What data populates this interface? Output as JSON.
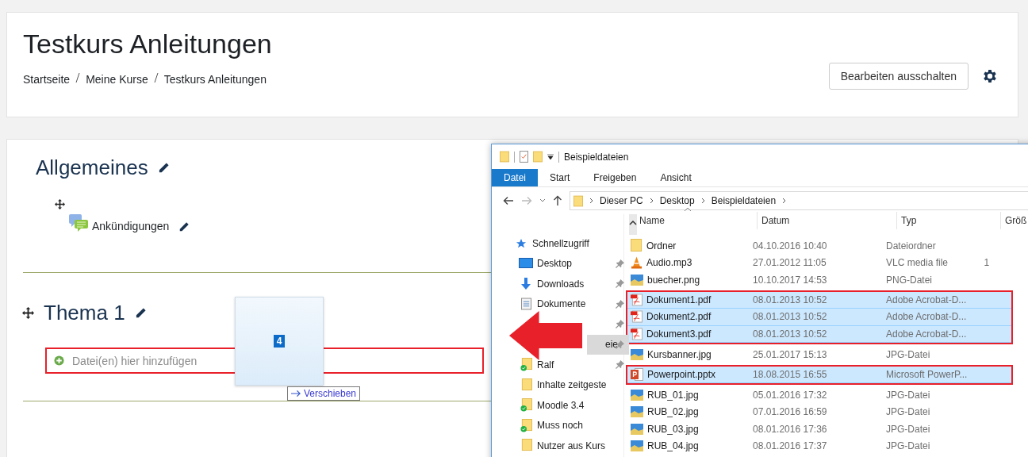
{
  "page": {
    "title": "Testkurs Anleitungen",
    "breadcrumb": [
      "Startseite",
      "Meine Kurse",
      "Testkurs Anleitungen"
    ],
    "edit_button": "Bearbeiten ausschalten"
  },
  "sections": [
    {
      "title": "Allgemeines",
      "movable": false,
      "activities": [
        "Ankündigungen"
      ]
    },
    {
      "title": "Thema 1",
      "movable": true,
      "dropzone": "Datei(en) hier hinzufügen"
    }
  ],
  "drag": {
    "count": "4",
    "tooltip": "Verschieben"
  },
  "explorer": {
    "title": "Beispieldateien",
    "ribbon_tabs": [
      {
        "label": "Datei",
        "selected": true
      },
      {
        "label": "Start",
        "selected": false
      },
      {
        "label": "Freigeben",
        "selected": false
      },
      {
        "label": "Ansicht",
        "selected": false
      }
    ],
    "path": [
      "Dieser PC",
      "Desktop",
      "Beispieldateien"
    ],
    "nav": [
      {
        "kind": "star",
        "label": "Schnellzugriff",
        "pinned": false,
        "selected": false,
        "covered": false
      },
      {
        "kind": "desktop",
        "label": "Desktop",
        "pinned": true,
        "selected": false,
        "covered": false
      },
      {
        "kind": "download",
        "label": "Downloads",
        "pinned": true,
        "selected": false,
        "covered": false
      },
      {
        "kind": "document",
        "label": "Dokumente",
        "pinned": true,
        "selected": false,
        "covered": false
      },
      {
        "kind": "hidden",
        "pinned": true,
        "selected": false,
        "covered": true
      },
      {
        "kind": "hidden",
        "label": "eie",
        "pinned": true,
        "selected": true,
        "covered": true
      },
      {
        "kind": "folder",
        "label": "Ralf",
        "pinned": true,
        "synced": true,
        "selected": false,
        "covered": false
      },
      {
        "kind": "folder",
        "label": "Inhalte zeitgeste",
        "pinned": false,
        "synced": false,
        "selected": false,
        "covered": false
      },
      {
        "kind": "folder",
        "label": "Moodle 3.4",
        "pinned": false,
        "synced": true,
        "selected": false,
        "covered": false
      },
      {
        "kind": "folder",
        "label": "Muss noch",
        "pinned": false,
        "synced": true,
        "selected": false,
        "covered": false
      },
      {
        "kind": "folder",
        "label": "Nutzer aus Kurs",
        "pinned": false,
        "synced": false,
        "selected": false,
        "covered": false
      }
    ],
    "columns": [
      "Name",
      "Datum",
      "Typ",
      "Größ"
    ],
    "files": [
      {
        "kind": "folder",
        "name": "Ordner",
        "date": "04.10.2016 10:40",
        "type": "Dateiordner",
        "selected": false
      },
      {
        "kind": "audio",
        "name": "Audio.mp3",
        "date": "27.01.2012 11:05",
        "type": "VLC media file",
        "size": "1",
        "selected": false
      },
      {
        "kind": "image",
        "name": "buecher.png",
        "date": "10.10.2017 14:53",
        "type": "PNG-Datei",
        "selected": false
      },
      {
        "kind": "pdf",
        "name": "Dokument1.pdf",
        "date": "08.01.2013 10:52",
        "type": "Adobe Acrobat-D...",
        "selected": true
      },
      {
        "kind": "pdf",
        "name": "Dokument2.pdf",
        "date": "08.01.2013 10:52",
        "type": "Adobe Acrobat-D...",
        "selected": true
      },
      {
        "kind": "pdf",
        "name": "Dokument3.pdf",
        "date": "08.01.2013 10:52",
        "type": "Adobe Acrobat-D...",
        "selected": true
      },
      {
        "kind": "image",
        "name": "Kursbanner.jpg",
        "date": "25.01.2017 15:13",
        "type": "JPG-Datei",
        "selected": false
      },
      {
        "kind": "pptx",
        "name": "Powerpoint.pptx",
        "date": "18.08.2015 16:55",
        "type": "Microsoft PowerP...",
        "selected": true
      },
      {
        "kind": "image",
        "name": "RUB_01.jpg",
        "date": "05.01.2016 17:32",
        "type": "JPG-Datei",
        "selected": false
      },
      {
        "kind": "image",
        "name": "RUB_02.jpg",
        "date": "07.01.2016 16:59",
        "type": "JPG-Datei",
        "selected": false
      },
      {
        "kind": "image",
        "name": "RUB_03.jpg",
        "date": "08.01.2016 17:36",
        "type": "JPG-Datei",
        "selected": false
      },
      {
        "kind": "image",
        "name": "RUB_04.jpg",
        "date": "08.01.2016 17:37",
        "type": "JPG-Datei",
        "selected": false
      }
    ]
  }
}
